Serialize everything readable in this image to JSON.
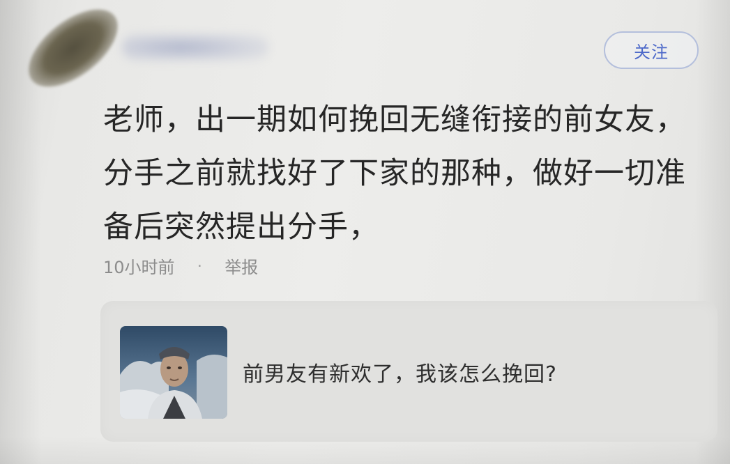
{
  "post": {
    "follow_label": "关注",
    "text": "老师，出一期如何挽回无缝衔接的前女友，分手之前就找好了下家的那种，做好一切准备后突然提出分手，",
    "time": "10小时前",
    "separator": "·",
    "report_label": "举报"
  },
  "card": {
    "title": "前男友有新欢了，我该怎么挽回?"
  },
  "colors": {
    "accent": "#4c68c9",
    "follow_border": "#b4bfdc",
    "text": "#262626",
    "meta": "#8c8c8c",
    "card_bg": "#e1e1df"
  }
}
